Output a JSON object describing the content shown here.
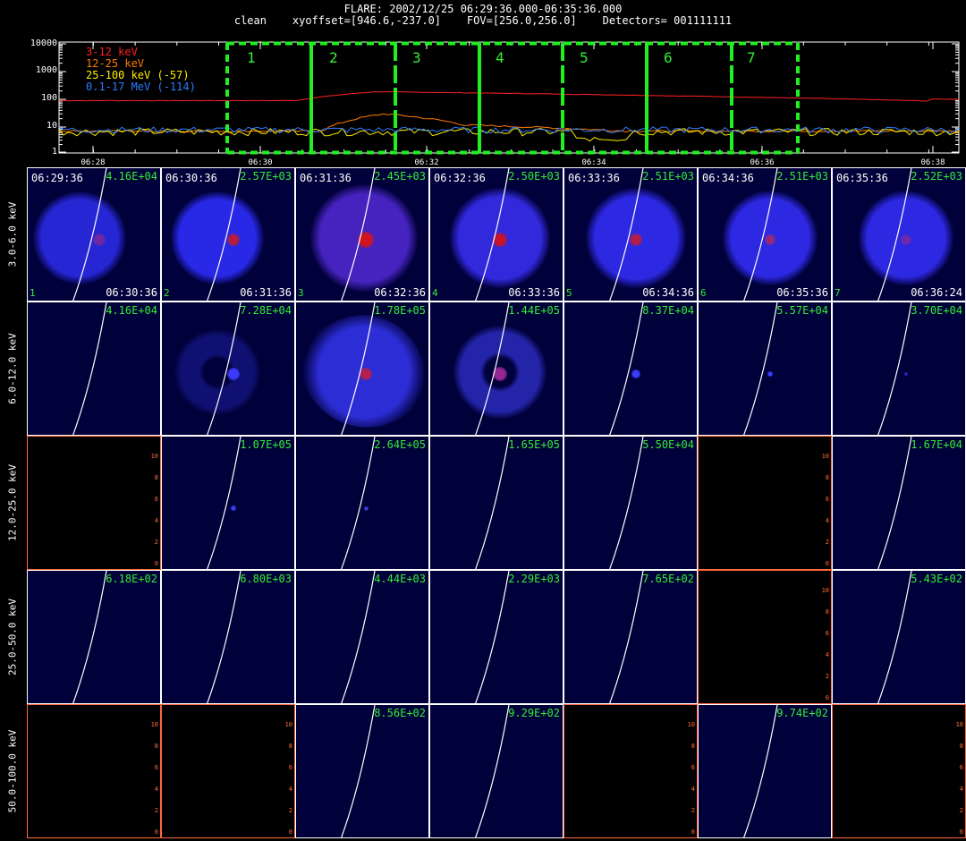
{
  "header": {
    "title": "FLARE: 2002/12/25 06:29:36.000-06:35:36.000",
    "subtitle": "clean    xyoffset=[946.6,-237.0]    FOV=[256.0,256.0]    Detectors= 001111111"
  },
  "lightcurve": {
    "y_ticks": [
      "10000",
      "1000",
      "100",
      "10",
      "1"
    ],
    "x_ticks": [
      "06:28",
      "06:30",
      "06:32",
      "06:34",
      "06:36",
      "06:38"
    ],
    "legend": [
      {
        "label": "3-12 keV",
        "color": "#ff2020"
      },
      {
        "label": "12-25 keV",
        "color": "#ff7a00"
      },
      {
        "label": "25-100 keV (-57)",
        "color": "#ffee00"
      },
      {
        "label": "0.1-17 MeV (-114)",
        "color": "#2a7dff"
      }
    ],
    "segments": [
      "1",
      "2",
      "3",
      "4",
      "5",
      "6",
      "7"
    ],
    "segment_color": "#22ee22"
  },
  "bands": [
    "3.0-6.0 keV",
    "6.0-12.0 keV",
    "12.0-25.0 keV",
    "25.0-50.0 keV",
    "50.0-100.0 keV"
  ],
  "start_times": [
    "06:29:36",
    "06:30:36",
    "06:31:36",
    "06:32:36",
    "06:33:36",
    "06:34:36",
    "06:35:36"
  ],
  "end_times": [
    "06:30:36",
    "06:31:36",
    "06:32:36",
    "06:33:36",
    "06:34:36",
    "06:35:36",
    "06:36:24"
  ],
  "maxima": [
    [
      "4.16E+04",
      "2.57E+03",
      "2.45E+03",
      "2.50E+03",
      "2.51E+03",
      "2.51E+03",
      "2.52E+03"
    ],
    [
      "4.16E+04",
      "7.28E+04",
      "1.78E+05",
      "1.44E+05",
      "8.37E+04",
      "5.57E+04",
      "3.70E+04"
    ],
    [
      "",
      "1.07E+05",
      "2.64E+05",
      "1.65E+05",
      "5.50E+04",
      "",
      "1.67E+04"
    ],
    [
      "6.18E+02",
      "6.80E+03",
      "4.44E+03",
      "2.29E+03",
      "7.65E+02",
      "",
      "5.43E+02"
    ],
    [
      "",
      "",
      "8.56E+02",
      "9.29E+02",
      "",
      "9.74E+02",
      ""
    ]
  ],
  "empty_ticks": [
    "0",
    "2",
    "4",
    "6",
    "8",
    "10"
  ]
}
